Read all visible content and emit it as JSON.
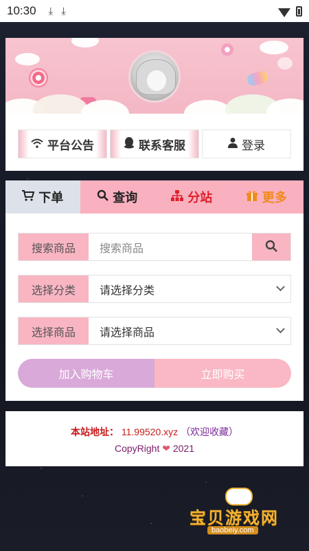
{
  "status_bar": {
    "time": "10:30",
    "icons": [
      "download-icon",
      "download-icon",
      "wifi-icon",
      "battery-icon"
    ]
  },
  "header": {
    "tabs": [
      {
        "label": "平台公告",
        "icon": "wifi-icon"
      },
      {
        "label": "联系客服",
        "icon": "qq-icon"
      },
      {
        "label": "登录",
        "icon": "user-icon"
      }
    ]
  },
  "nav": {
    "items": [
      {
        "label": "下单",
        "icon": "cart-icon",
        "color": "#222222"
      },
      {
        "label": "查询",
        "icon": "search-icon",
        "color": "#222222"
      },
      {
        "label": "分站",
        "icon": "sitemap-icon",
        "color": "#e0202c"
      },
      {
        "label": "更多",
        "icon": "gift-icon",
        "color": "#f08a1a"
      }
    ]
  },
  "form": {
    "search_label": "搜索商品",
    "search_placeholder": "搜索商品",
    "category_label": "选择分类",
    "category_value": "请选择分类",
    "product_label": "选择商品",
    "product_value": "请选择商品",
    "add_to_cart": "加入购物车",
    "buy_now": "立即购买"
  },
  "footer": {
    "site_label": "本站地址：",
    "site_address": "11.99520.xyz",
    "site_suffix": "（欢迎收藏）",
    "copyright_prefix": "CopyRight",
    "copyright_year": "2021"
  },
  "watermark": {
    "text": "宝贝游戏网",
    "url": "baobeiy.com"
  },
  "colors": {
    "accent_pink": "#f9b1bf",
    "active_tab": "#dde2ea",
    "cart_button": "#d9a9d9",
    "buy_button": "#f9b8c3"
  }
}
